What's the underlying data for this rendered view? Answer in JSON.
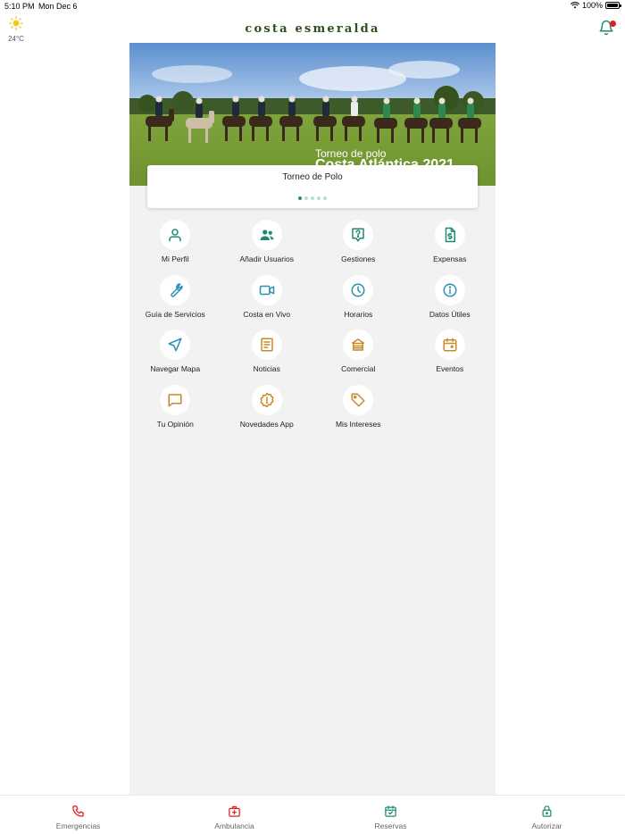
{
  "status_bar": {
    "time": "5:10 PM",
    "date": "Mon Dec 6",
    "battery": "100%",
    "battery_level": 1.0
  },
  "weather": {
    "temp": "24°C",
    "icon": "sun-icon"
  },
  "header": {
    "brand": "costa esmeralda",
    "notification_icon": "bell-icon",
    "has_unread": true
  },
  "hero": {
    "caption_top": "Torneo de polo",
    "caption_bottom": "Costa Atlántica 2021"
  },
  "carousel": {
    "title": "Torneo de Polo",
    "slide_count": 5,
    "active_index": 0
  },
  "colors": {
    "brand_green": "#2f4f1e",
    "teal": "#1f8a72",
    "blue": "#2b8fb3",
    "amber": "#c98a2b",
    "red": "#e11d1d"
  },
  "menu": [
    {
      "label": "Mi Perfil",
      "icon": "user-icon",
      "color": "#1f8a72"
    },
    {
      "label": "Añadir Usuarios",
      "icon": "users-icon",
      "color": "#1f8a72"
    },
    {
      "label": "Gestiones",
      "icon": "question-bubble-icon",
      "color": "#1f8a72"
    },
    {
      "label": "Expensas",
      "icon": "invoice-icon",
      "color": "#1f8a72"
    },
    {
      "label": "Guía de Servicios",
      "icon": "wrench-icon",
      "color": "#2b8fb3"
    },
    {
      "label": "Costa en Vivo",
      "icon": "video-camera-icon",
      "color": "#2b8fb3"
    },
    {
      "label": "Horarios",
      "icon": "clock-icon",
      "color": "#2b8fb3"
    },
    {
      "label": "Datos Útiles",
      "icon": "info-icon",
      "color": "#2b8fb3"
    },
    {
      "label": "Navegar Mapa",
      "icon": "navigation-icon",
      "color": "#2b8fb3"
    },
    {
      "label": "Noticias",
      "icon": "news-icon",
      "color": "#c98a2b"
    },
    {
      "label": "Comercial",
      "icon": "storefront-icon",
      "color": "#c98a2b"
    },
    {
      "label": "Eventos",
      "icon": "calendar-icon",
      "color": "#c98a2b"
    },
    {
      "label": "Tu Opinión",
      "icon": "chat-icon",
      "color": "#c98a2b"
    },
    {
      "label": "Novedades App",
      "icon": "alert-badge-icon",
      "color": "#c98a2b"
    },
    {
      "label": "Mis Intereses",
      "icon": "tag-icon",
      "color": "#c98a2b"
    }
  ],
  "bottom_nav": [
    {
      "label": "Emergencias",
      "icon": "phone-icon",
      "color": "#e11d1d"
    },
    {
      "label": "Ambulancia",
      "icon": "medical-kit-icon",
      "color": "#e11d1d"
    },
    {
      "label": "Reservas",
      "icon": "calendar-check-icon",
      "color": "#1f8a72"
    },
    {
      "label": "Autorizar",
      "icon": "lock-icon",
      "color": "#1f8a72"
    }
  ]
}
